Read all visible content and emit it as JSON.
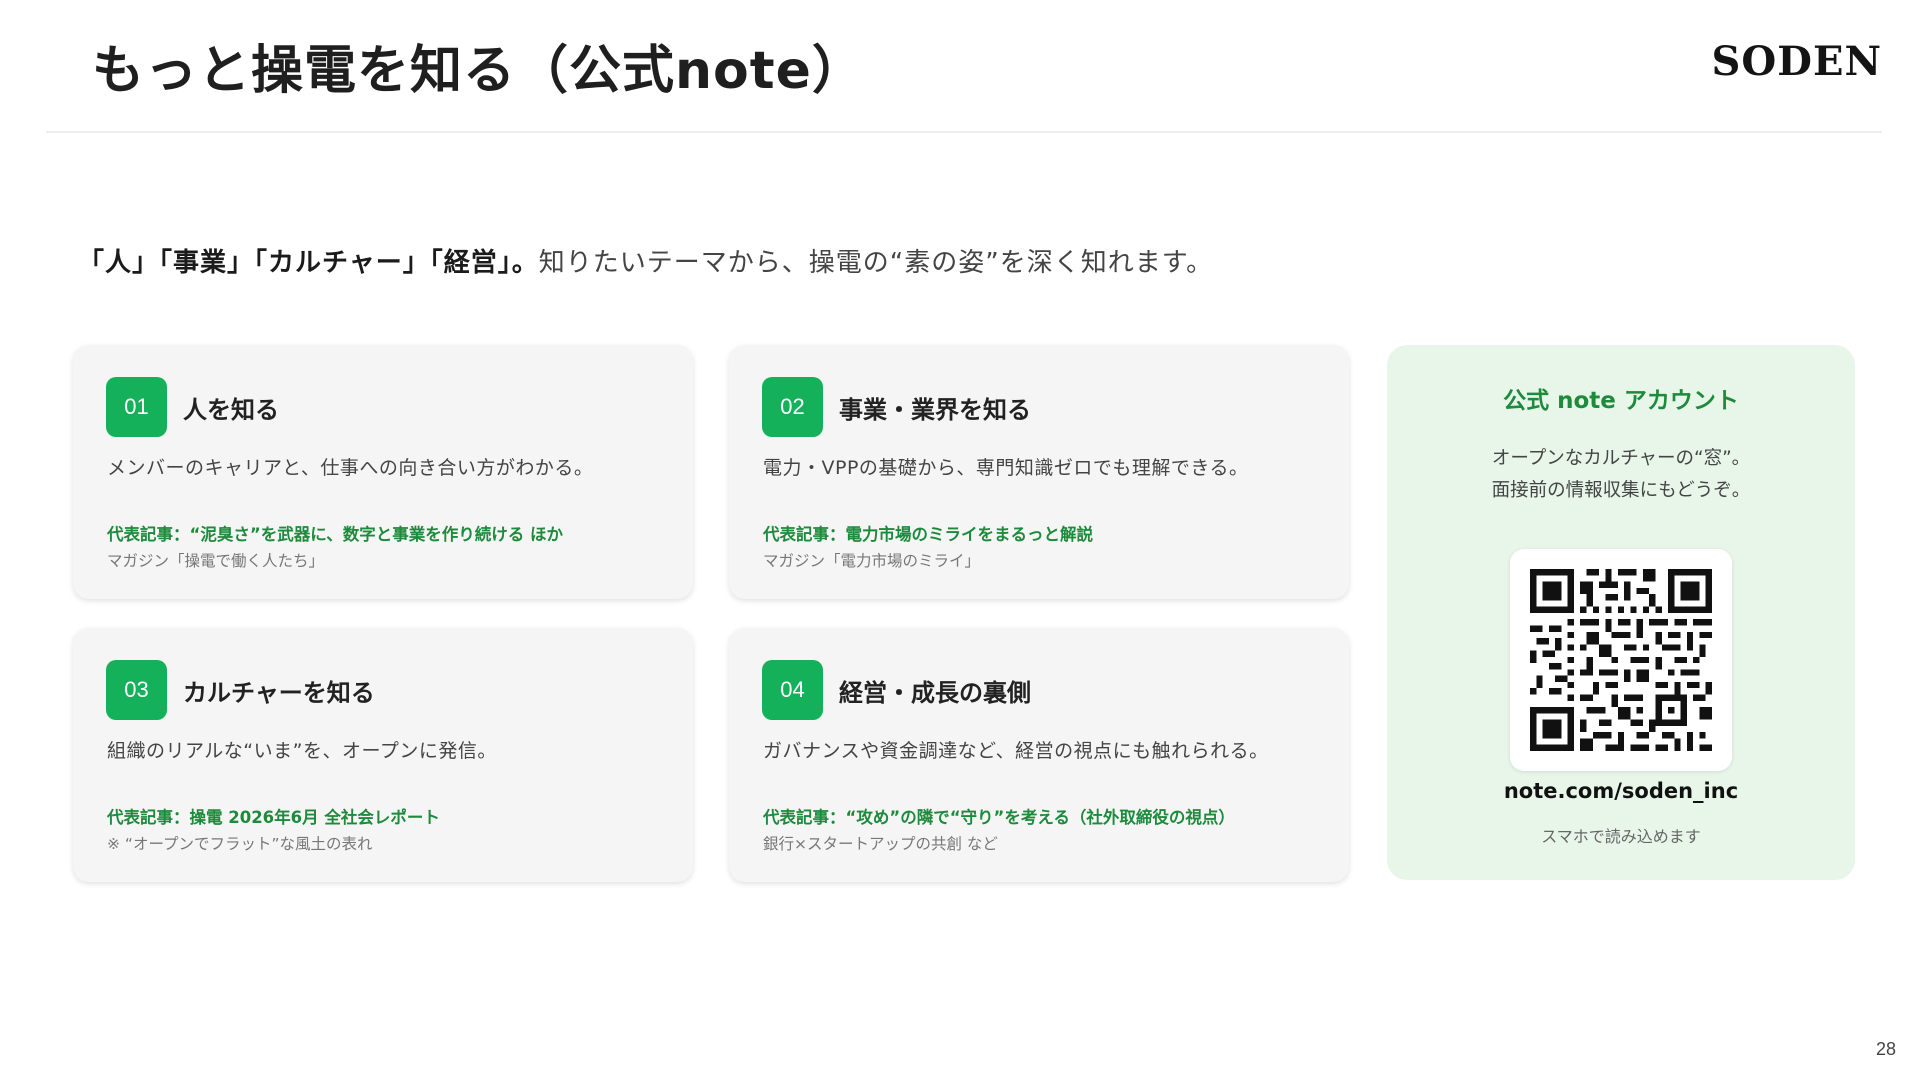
{
  "page": {
    "title": "もっと操電を知る（公式note）",
    "logo": "SODEN",
    "page_number": "28"
  },
  "lead": {
    "bold": "「人」「事業」「カルチャー」「経営」。",
    "rest": "知りたいテーマから、操電の“素の姿”を深く知れます。"
  },
  "cards": [
    {
      "number": "01",
      "title": "人を知る",
      "description": "メンバーのキャリアと、仕事への向き合い方がわかる。",
      "article": "代表記事：“泥臭さ”を武器に、数字と事業を作り続ける ほか",
      "magazine": "マガジン「操電で働く人たち」"
    },
    {
      "number": "02",
      "title": "事業・業界を知る",
      "description": "電力・VPPの基礎から、専門知識ゼロでも理解できる。",
      "article": "代表記事：電力市場のミライをまるっと解説",
      "magazine": "マガジン「電力市場のミライ」"
    },
    {
      "number": "03",
      "title": "カルチャーを知る",
      "description": "組織のリアルな“いま”を、オープンに発信。",
      "article": "代表記事：操電 2026年6月 全社会レポート",
      "magazine": "※ “オープンでフラット”な風土の表れ"
    },
    {
      "number": "04",
      "title": "経営・成長の裏側",
      "description": "ガバナンスや資金調達など、経営の視点にも触れられる。",
      "article": "代表記事：“攻め”の隣で“守り”を考える（社外取締役の視点）",
      "magazine": "銀行×スタートアップの共創 など"
    }
  ],
  "note_panel": {
    "heading": "公式 note アカウント",
    "description_line1": "オープンなカルチャーの“窓”。",
    "description_line2": "面接前の情報収集にもどうぞ。",
    "url": "note.com/soden_inc",
    "caption": "スマホで読み込めます"
  },
  "colors": {
    "accent_green": "#14b05a",
    "article_green": "#1e8a3c",
    "panel_bg": "#e8f6ea",
    "card_bg": "#f5f5f5"
  }
}
